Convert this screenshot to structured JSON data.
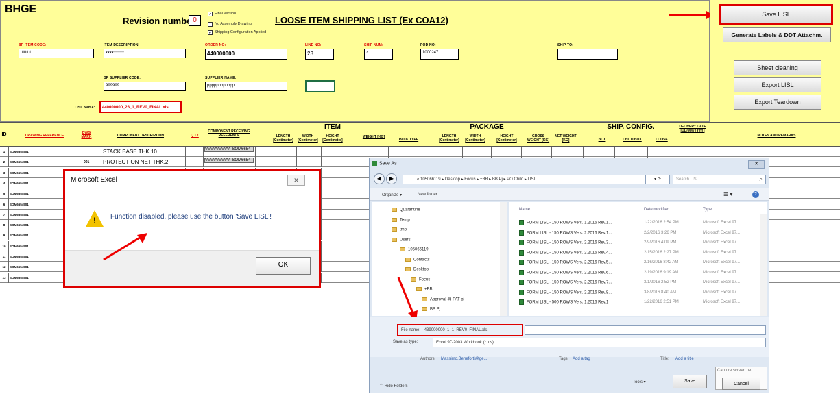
{
  "header": {
    "company": "BHGE",
    "revision_label": "Revision number",
    "revision_value": "0",
    "title": "LOOSE ITEM SHIPPING LIST (Ex COA12)",
    "options": [
      {
        "label": "Final version",
        "checked": true
      },
      {
        "label": "No Assembly Drawing",
        "checked": false
      },
      {
        "label": "Shipping Configuration Applied",
        "checked": true
      }
    ],
    "fields": {
      "bp_item_code": {
        "label": "BP ITEM CODE:",
        "value": "ttttttttt"
      },
      "item_description": {
        "label": "ITEM DESCRIPTION:",
        "value": "xxxxxxxxx"
      },
      "order_no": {
        "label": "ORDER NO:",
        "value": "440000000"
      },
      "line_no": {
        "label": "LINE NO:",
        "value": "23"
      },
      "ship_num": {
        "label": "SHIP NUM:",
        "value": "1"
      },
      "pod_no": {
        "label": "POD NO:",
        "value": "1000247"
      },
      "ship_to": {
        "label": "SHIP TO:",
        "value": ""
      },
      "bp_supplier_code": {
        "label": "BP SUPPLIER CODE:",
        "value": "999999"
      },
      "supplier_name": {
        "label": "SUPPLIER NAME:",
        "value": "pppppppppppp"
      },
      "lisl_name": {
        "label": "LISL Name:",
        "value": "440000000_23_1_REV0_FINAL.xls"
      }
    }
  },
  "right_panel": {
    "save_label": "Save LISL",
    "generate_label": "Generate Labels & DDT Attachm.",
    "sheet_cleaning_label": "Sheet cleaning",
    "export_label": "Export LISL",
    "export_teardown_label": "Export Teardown"
  },
  "table": {
    "group_item": "ITEM",
    "group_package": "PACKAGE",
    "group_ship": "SHIP. CONFIG.",
    "columns": {
      "id": "ID",
      "drawing_ref": "DRAWING REFERENCE",
      "dwg_mark": "DWG MARK",
      "component_desc": "COMPONENT DESCRIPTION",
      "qty": "Q.TY",
      "receiving_ref": "COMPONENT RECEIVING REFERENCE",
      "length": "LENGTH [Centimeter]",
      "width": "WIDTH [Centimeter]",
      "height": "HEIGHT [Centimeter]",
      "weight": "WEIGHT [KG]",
      "pack_type": "PACK TYPE",
      "p_length": "LENGTH [Centimeter]",
      "p_width": "WIDTH [Centimeter]",
      "p_height": "HEIGHT [Centimeter]",
      "gross": "GROSS WEIGHT [KG]",
      "net": "NET WEIGHT [KG]",
      "box": "BOX",
      "child_box": "CHILD BOX",
      "loose": "LOOSE",
      "delivery": "DELIVERY DATE [DD/MM/YYYY]",
      "notes": "NOTES AND REMARKS"
    },
    "first_row": {
      "desc": "STACK BASE THK.10",
      "recv": "VVVVVVVVV_SOM6654_501_A"
    },
    "second_row": {
      "mark": "001",
      "desc": "PROTECTION NET THK.2",
      "recv": "VVVVVVVVV_SOM6654"
    },
    "rows": [
      {
        "id": "1",
        "ref": "SOM6654501"
      },
      {
        "id": "2",
        "ref": "SOM6654501"
      },
      {
        "id": "3",
        "ref": "SOM6654501"
      },
      {
        "id": "4",
        "ref": "SOM6654501"
      },
      {
        "id": "5",
        "ref": "SOM6654501"
      },
      {
        "id": "6",
        "ref": "SOM6654501"
      },
      {
        "id": "7",
        "ref": "SOM6654501"
      },
      {
        "id": "8",
        "ref": "SOM6654501"
      },
      {
        "id": "9",
        "ref": "SOM6654501"
      },
      {
        "id": "10",
        "ref": "SOM6654501"
      },
      {
        "id": "11",
        "ref": "SOM6654501"
      },
      {
        "id": "12",
        "ref": "SOM6654501"
      },
      {
        "id": "13",
        "ref": "SOM6654501"
      }
    ]
  },
  "excel_dialog": {
    "title": "Microsoft Excel",
    "message": "Function disabled, please use the button 'Save LISL'!",
    "ok_label": "OK"
  },
  "save_dialog": {
    "title": "Save As",
    "breadcrumb": "« 105066119 ▸ Desktop ▸ Focus ▸ +BB ▸ BB Pj ▸ PO Child ▸ LISL",
    "search_placeholder": "Search LISL",
    "organize_label": "Organize ▾",
    "new_folder_label": "New folder",
    "col_name": "Name",
    "col_date": "Date modified",
    "col_type": "Type",
    "folders": [
      "Quarantine",
      "Temp",
      "tmp",
      "Users",
      "105066119",
      "Contacts",
      "Desktop",
      "Focus",
      "+BB",
      "Approval @ FAT pj",
      "BB Pj"
    ],
    "files": [
      {
        "name": "FORM LISL - 150 ROWS Vers. 1.2016 Rev.1...",
        "date": "1/22/2016 2:54 PM",
        "type": "Microsoft Excel 97..."
      },
      {
        "name": "FORM LISL - 150 ROWS Vers. 2.2016 Rev.1...",
        "date": "2/2/2016 3:26 PM",
        "type": "Microsoft Excel 97..."
      },
      {
        "name": "FORM LISL - 150 ROWS Vers. 2.2016 Rev.3...",
        "date": "2/9/2016 4:09 PM",
        "type": "Microsoft Excel 97..."
      },
      {
        "name": "FORM LISL - 150 ROWS Vers. 2.2016 Rev.4...",
        "date": "2/15/2016 2:27 PM",
        "type": "Microsoft Excel 97..."
      },
      {
        "name": "FORM LISL - 150 ROWS Vers. 2.2016 Rev.5...",
        "date": "2/16/2016 8:42 AM",
        "type": "Microsoft Excel 97..."
      },
      {
        "name": "FORM LISL - 150 ROWS Vers. 2.2016 Rev.6...",
        "date": "2/19/2016 9:19 AM",
        "type": "Microsoft Excel 97..."
      },
      {
        "name": "FORM LISL - 150 ROWS Vers. 2.2016 Rev.7...",
        "date": "3/1/2016 2:52 PM",
        "type": "Microsoft Excel 97..."
      },
      {
        "name": "FORM LISL - 150 ROWS Vers. 2.2016 Rev.8...",
        "date": "3/8/2016 8:40 AM",
        "type": "Microsoft Excel 97..."
      },
      {
        "name": "FORM LISL - 500 ROWS Vers. 1.2016 Rev.1",
        "date": "1/22/2016 2:51 PM",
        "type": "Microsoft Excel 97..."
      }
    ],
    "filename_label": "File name:",
    "filename_value": "439000000_1_1_REV0_FINAL.xls",
    "savetype_label": "Save as type:",
    "savetype_value": "Excel 97-2003 Workbook (*.xls)",
    "authors_label": "Authors:",
    "authors_value": "Massimo.Beneforti@ge...",
    "tags_label": "Tags:",
    "tags_value": "Add a tag",
    "titlefield_label": "Title:",
    "titlefield_value": "Add a title",
    "hide_folders": "Hide Folders",
    "tools_label": "Tools ▾",
    "save_label": "Save",
    "cancel_label": "Cancel",
    "tooltip": "Capture screen ne"
  },
  "colors": {
    "header_yellow": "#fffe99",
    "highlight_red": "#dd0000"
  }
}
